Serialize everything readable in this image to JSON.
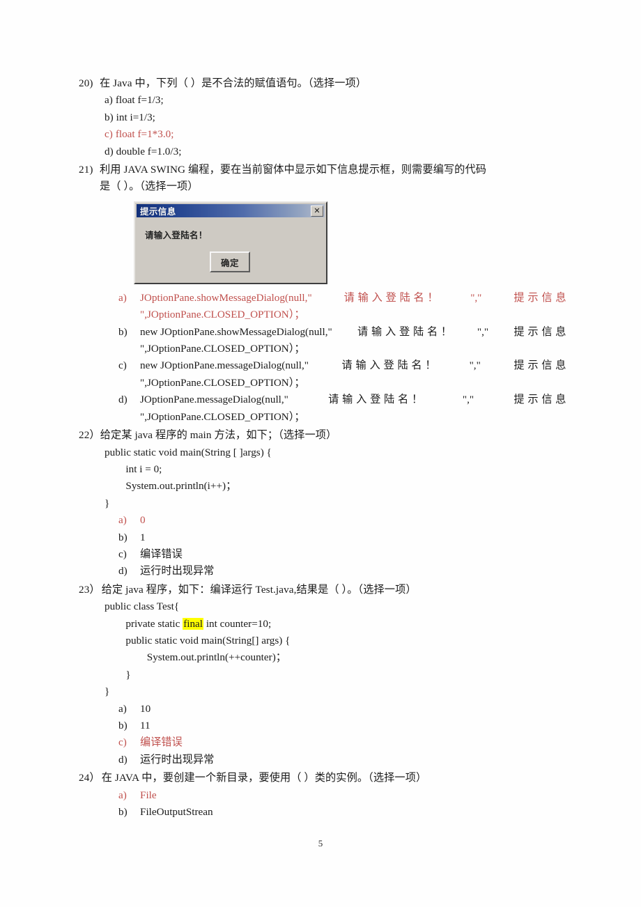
{
  "page": {
    "number": "5"
  },
  "questions": [
    {
      "id": "q20",
      "number": "20)",
      "stem": "在 Java 中，下列（  ）是不合法的赋值语句。（选择一项）",
      "options": [
        {
          "label": "a)",
          "text": "float f=1/3;",
          "color": "black"
        },
        {
          "label": "b)",
          "text": "int i=1/3;",
          "color": "black"
        },
        {
          "label": "c)",
          "text": "float f=1*3.0;",
          "color": "red"
        },
        {
          "label": "d)",
          "text": "double f=1.0/3;",
          "color": "black"
        }
      ]
    },
    {
      "id": "q21",
      "number": "21)",
      "stem_line1": "利用 JAVA SWING  编程，要在当前窗体中显示如下信息提示框，则需要编写的代码",
      "stem_line2": "是（ ）。（选择一项）",
      "dialog": {
        "title": "提示信息",
        "close_label": "✕",
        "message": "请输入登陆名！",
        "ok_label": "确定"
      },
      "options": [
        {
          "label": "a)",
          "color": "red",
          "line1_left": "JOptionPane.showMessageDialog(null,\"",
          "line1_cjk": "请 输 入 登 陆 名 ！",
          "line1_mid": "\",\"",
          "line1_cjk2": "提 示 信 息",
          "line2": "\",JOptionPane.CLOSED_OPTION）；"
        },
        {
          "label": "b)",
          "color": "black",
          "line1_left": "new  JOptionPane.showMessageDialog(null,\"",
          "line1_cjk": "请 输 入 登 陆 名 ！",
          "line1_mid": "\",\"",
          "line1_cjk2": "提 示 信 息",
          "line2": "\",JOptionPane.CLOSED_OPTION）；"
        },
        {
          "label": "c)",
          "color": "black",
          "line1_left": "new  JOptionPane.messageDialog(null,\"",
          "line1_cjk": "请 输 入 登 陆 名 ！",
          "line1_mid": "\",\"",
          "line1_cjk2": "提 示 信 息",
          "line2": "\",JOptionPane.CLOSED_OPTION）；"
        },
        {
          "label": "d)",
          "color": "black",
          "line1_left": "JOptionPane.messageDialog(null,\"",
          "line1_cjk": "请 输 入 登 陆 名 ！",
          "line1_mid": "\",\"",
          "line1_cjk2": "提 示 信 息",
          "line2": "\",JOptionPane.CLOSED_OPTION）；"
        }
      ]
    },
    {
      "id": "q22",
      "number": "22）",
      "stem": "给定某 java 程序的 main 方法，如下；（选择一项）",
      "code": [
        "public static void main(String [ ]args) {",
        "        int i = 0;",
        "        System.out.println(i++)；",
        "}"
      ],
      "options": [
        {
          "label": "a)",
          "text": "0",
          "color": "red"
        },
        {
          "label": "b)",
          "text": "1",
          "color": "black"
        },
        {
          "label": "c)",
          "text": "编译错误",
          "color": "black"
        },
        {
          "label": "d)",
          "text": "运行时出现异常",
          "color": "black"
        }
      ]
    },
    {
      "id": "q23",
      "number": "23）",
      "stem": "给定 java 程序，如下：编译运行 Test.java,结果是（  ）。（选择一项）",
      "code_line1": "public class Test{",
      "code_line2_pre": "        private static ",
      "code_line2_hl": "final",
      "code_line2_post": " int counter=10;",
      "code_rest": [
        "        public static void main(String[] args) {",
        "                System.out.println(++counter)；",
        "        }",
        "}"
      ],
      "options": [
        {
          "label": "a)",
          "text": "10",
          "color": "black"
        },
        {
          "label": "b)",
          "text": "11",
          "color": "black"
        },
        {
          "label": "c)",
          "text": "编译错误",
          "color": "red"
        },
        {
          "label": "d)",
          "text": "运行时出现异常",
          "color": "black"
        }
      ]
    },
    {
      "id": "q24",
      "number": "24）",
      "stem": "在 JAVA 中，要创建一个新目录，要使用（ ）类的实例。（选择一项）",
      "options": [
        {
          "label": "a)",
          "text": "File",
          "color": "red"
        },
        {
          "label": "b)",
          "text": "FileOutputStrean",
          "color": "black"
        }
      ]
    }
  ],
  "colors": {
    "answer_red": "#c0504d",
    "body_black": "#1a1a1a",
    "highlight_yellow": "#ffff00",
    "dialog_face": "#d4d0c8",
    "dialog_title_blue": "#0a2a7a"
  }
}
